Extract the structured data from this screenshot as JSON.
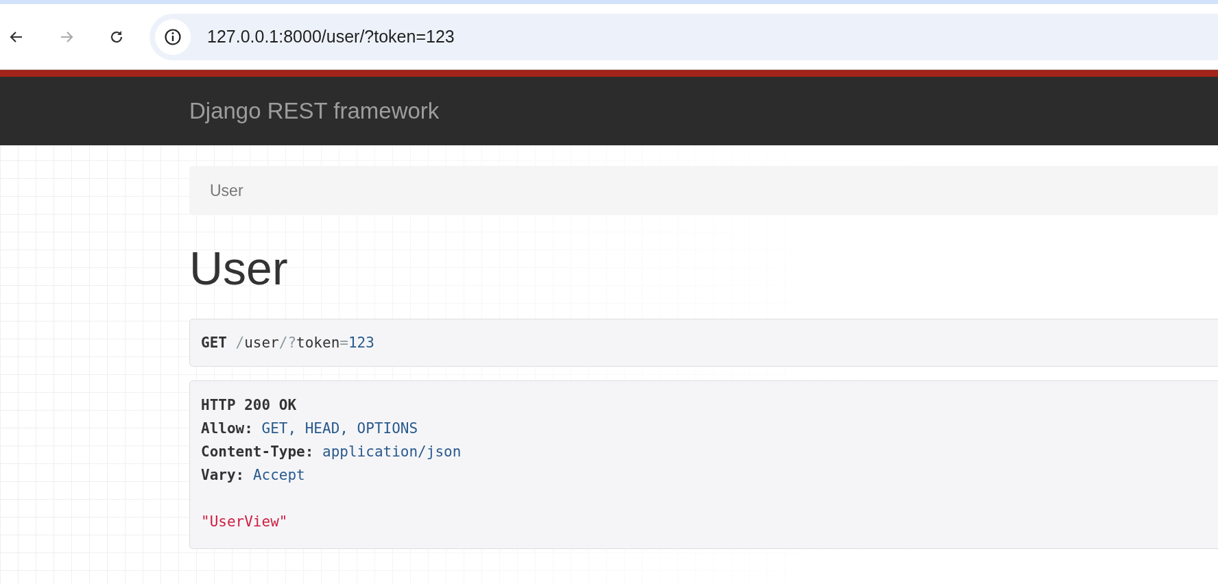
{
  "browser": {
    "url": "127.0.0.1:8000/user/?token=123",
    "back_disabled": false,
    "forward_disabled": true
  },
  "navbar": {
    "brand": "Django REST framework"
  },
  "breadcrumb": [
    {
      "label": "User"
    }
  ],
  "heading": "User",
  "request": {
    "tokens": [
      {
        "text": "GET",
        "kind": "keyword"
      },
      {
        "text": "/",
        "kind": "punct"
      },
      {
        "text": "user",
        "kind": "plain"
      },
      {
        "text": "/?",
        "kind": "punct"
      },
      {
        "text": "token",
        "kind": "plain"
      },
      {
        "text": "=",
        "kind": "punct"
      },
      {
        "text": "123",
        "kind": "number"
      }
    ]
  },
  "response": {
    "status": "HTTP 200 OK",
    "headers": [
      {
        "name": "Allow:",
        "value": "GET, HEAD, OPTIONS"
      },
      {
        "name": "Content-Type:",
        "value": "application/json"
      },
      {
        "name": "Vary:",
        "value": "Accept"
      }
    ],
    "body": "\"UserView\""
  }
}
